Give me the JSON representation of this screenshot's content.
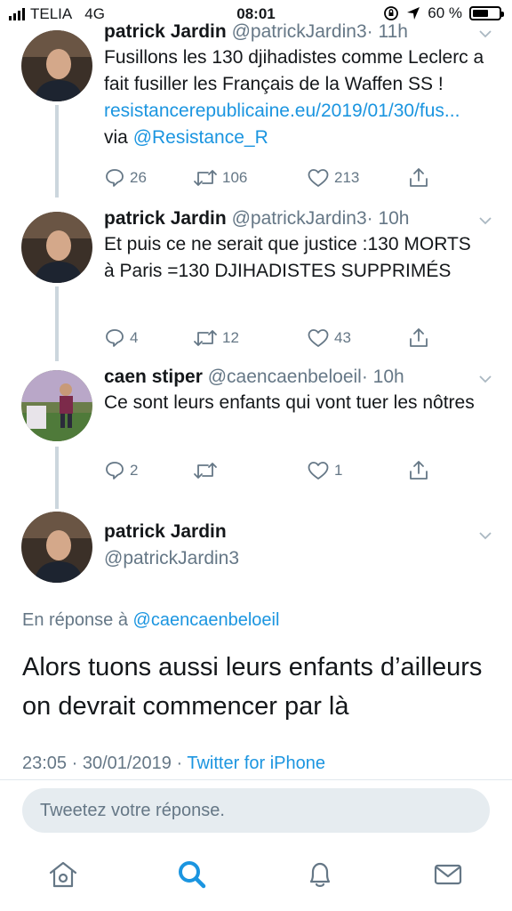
{
  "status_bar": {
    "carrier": "TELIA",
    "network": "4G",
    "time": "08:01",
    "battery": "60 %",
    "battery_level": 0.6
  },
  "thread": [
    {
      "name": "patrick Jardin",
      "handle": "@patrickJardin3",
      "time": "· 11h",
      "text": "Fusillons les 130 djihadistes comme Leclerc a fait fusiller les Français de la Waffen SS ! ",
      "link": "resistancerepublicaine.eu/2019/01/30/fus...",
      "via": " via ",
      "via_handle": "@Resistance_R",
      "replies": "26",
      "retweets": "106",
      "likes": "213"
    },
    {
      "name": "patrick Jardin",
      "handle": "@patrickJardin3",
      "time": "· 10h",
      "text": "Et puis ce ne serait que justice :130 MORTS à Paris =130 DJIHADISTES SUPPRIMÉS",
      "replies": "4",
      "retweets": "12",
      "likes": "43"
    },
    {
      "name": "caen stiper",
      "handle": "@caencaenbeloeil",
      "time": "· 10h",
      "text": "Ce sont leurs enfants qui vont tuer les nôtres",
      "replies": "2",
      "retweets": "",
      "likes": "1"
    }
  ],
  "main_tweet": {
    "name": "patrick Jardin",
    "handle": "@patrickJardin3",
    "reply_prefix": "En réponse à ",
    "reply_to": "@caencaenbeloeil",
    "text": "Alors tuons aussi leurs enfants d’ailleurs on devrait commencer par là",
    "timestamp": "23:05 · 30/01/2019 · ",
    "client": "Twitter for iPhone"
  },
  "compose": {
    "placeholder": "Tweetez votre réponse."
  },
  "tabs": [
    "home-icon",
    "search-icon",
    "notifications-icon",
    "messages-icon"
  ],
  "colors": {
    "accent": "#1b95e0",
    "muted": "#657786",
    "thread_line": "#ccd6dd",
    "compose_bg": "#e6ecf0"
  }
}
